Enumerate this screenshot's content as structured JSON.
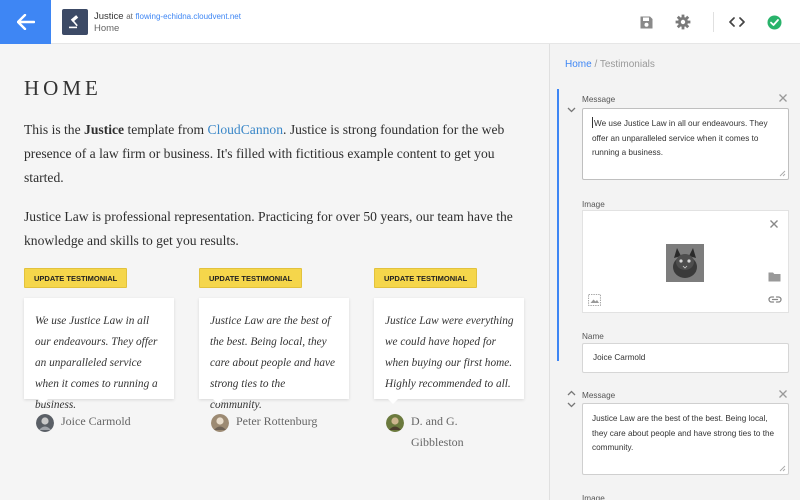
{
  "topbar": {
    "site_name": "Justice",
    "at": "at",
    "domain": "flowing-echidna.cloudvent.net",
    "page": "Home",
    "icons": [
      "arrow-left-icon",
      "save-icon",
      "gear-icon",
      "code-icon",
      "check-circle-icon"
    ],
    "colors": {
      "accent": "#3e86f4",
      "success": "#29b36b"
    }
  },
  "page": {
    "title": "HOME",
    "intro": {
      "p1_before": "This is the ",
      "p1_bold": "Justice",
      "p1_mid": " template from ",
      "p1_link": "CloudCannon",
      "p1_after": ". Justice is strong foundation for the web presence of a law firm or business. It's filled with fictitious example content to get you started."
    },
    "paragraph2": "Justice Law is professional representation. Practicing for over 50 years, our team have the knowledge and skills to get you results.",
    "update_label": "UPDATE TESTIMONIAL",
    "testimonials": [
      {
        "quote": "We use Justice Law in all our endeavours. They offer an unparalleled service when it comes to running a business.",
        "author": "Joice Carmold"
      },
      {
        "quote": "Justice Law are the best of the best. Being local, they care about people and have strong ties to the community.",
        "author": "Peter Rottenburg"
      },
      {
        "quote": "Justice Law were everything we could have hoped for when buying our first home. Highly recommended to all.",
        "author": "D. and G. Gibbleston"
      }
    ],
    "colors": {
      "link": "#3a87c8",
      "button": "#f5d64b"
    }
  },
  "editor": {
    "breadcrumb_home": "Home",
    "breadcrumb_sep": " / ",
    "breadcrumb_current": "Testimonials",
    "message_label": "Message",
    "image_label": "Image",
    "name_label": "Name",
    "item1": {
      "message": "We use Justice Law in all our endeavours. They offer an unparalleled service when it comes to running a business.",
      "name": "Joice Carmold"
    },
    "item2": {
      "message": "Justice Law are the best of the best. Being local, they care about people and have strong ties to the community."
    },
    "image_icons": [
      "close-icon",
      "folder-icon",
      "image-placeholder-icon",
      "link-icon"
    ]
  }
}
